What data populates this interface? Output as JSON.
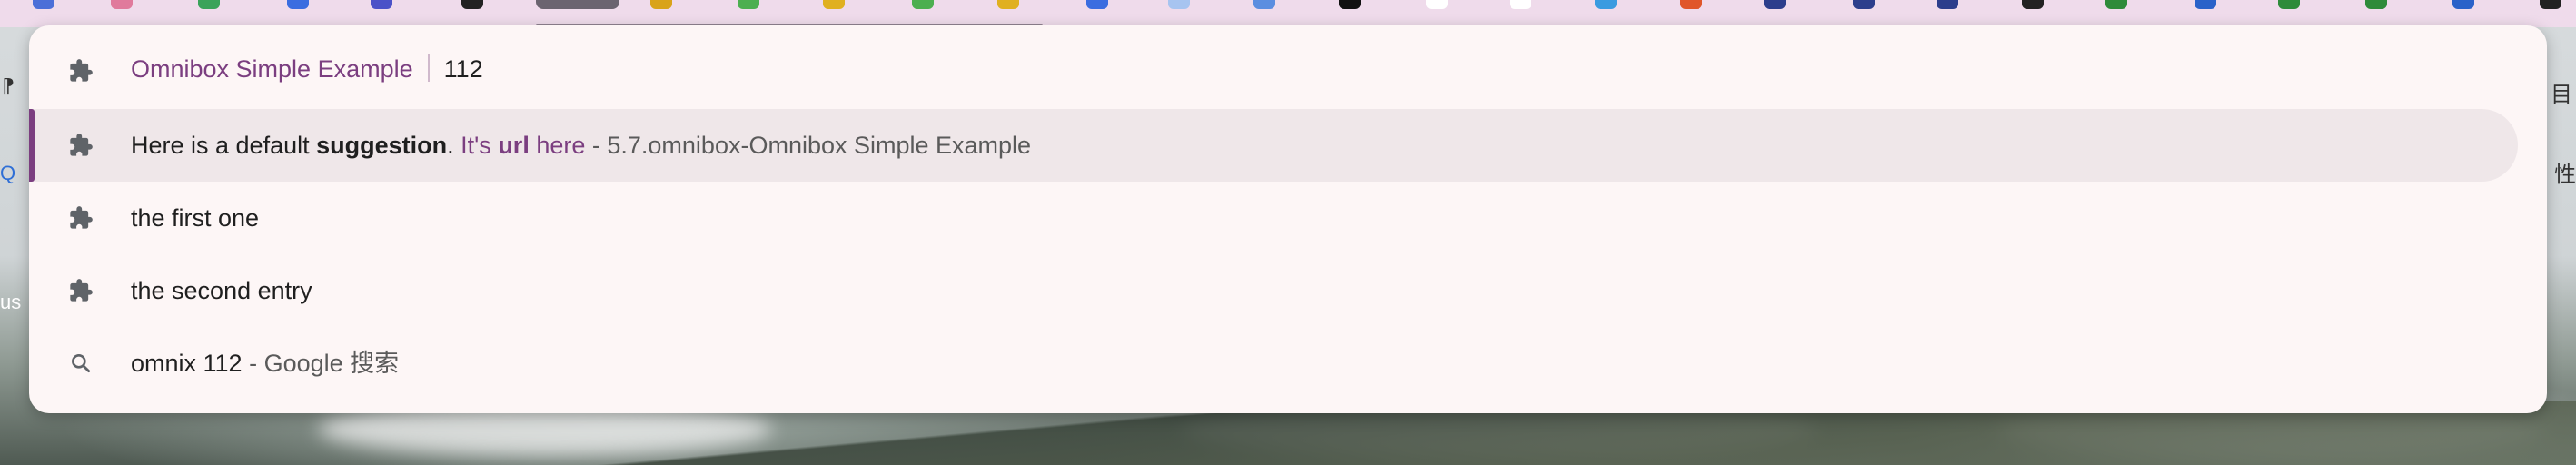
{
  "omnibox": {
    "keyword": "Omnibox Simple Example",
    "query": "112"
  },
  "suggestions": [
    {
      "icon": "puzzle-icon",
      "parts": [
        "Here is a default ",
        "suggestion",
        ". ",
        "It's ",
        "url",
        " here",
        " - 5.7.omnibox-Omnibox Simple Example"
      ]
    },
    {
      "icon": "puzzle-icon",
      "text": "the first one"
    },
    {
      "icon": "puzzle-icon",
      "text": "the second entry"
    },
    {
      "icon": "search-icon",
      "text": "omnix 112",
      "suffix": " - Google 搜索"
    }
  ],
  "edge": {
    "left_glyph_1": "⁋",
    "left_glyph_2": "Q",
    "left_glyph_3": "us",
    "right_glyph_1": "目",
    "right_glyph_2": "性"
  },
  "colors": {
    "accent": "#7b3e80",
    "dropdown_bg": "#fdf6f6",
    "selected_bg": "#efe7e9",
    "icon": "#5f6368"
  }
}
